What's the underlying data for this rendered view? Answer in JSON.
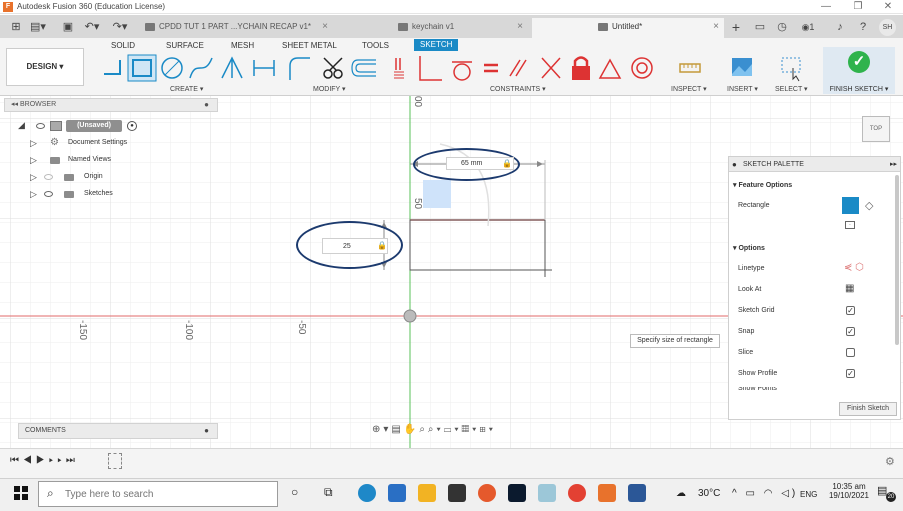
{
  "window": {
    "title": "Autodesk Fusion 360 (Education License)",
    "logo_letter": "F"
  },
  "tabs": [
    {
      "label": "CPDD TUT 1 PART ...YCHAIN RECAP v1*",
      "close": "×"
    },
    {
      "label": "keychain v1",
      "close": "×"
    },
    {
      "label": "Untitled*",
      "close": "×"
    }
  ],
  "tabbar_icons": {
    "new_tab": "+",
    "notification_count": "1",
    "avatar": "SH"
  },
  "ribbon": {
    "design_label": "DESIGN ▾",
    "tabs": [
      "SOLID",
      "SURFACE",
      "MESH",
      "SHEET METAL",
      "TOOLS",
      "SKETCH"
    ],
    "groups": [
      "CREATE ▾",
      "MODIFY ▾",
      "CONSTRAINTS ▾",
      "INSPECT ▾",
      "INSERT ▾",
      "SELECT ▾"
    ],
    "finish_sketch_label": "FINISH SKETCH ▾"
  },
  "browser": {
    "header": "BROWSER",
    "collapse": "◂◂",
    "root": "(Unsaved)",
    "items": [
      "Document Settings",
      "Named Views",
      "Origin",
      "Sketches"
    ]
  },
  "canvas": {
    "axis_labels": [
      "-150",
      "-100",
      "-50",
      "50",
      "00"
    ],
    "width_dim": "65 mm",
    "height_dim": "25",
    "tooltip": "Specify size of rectangle",
    "viewcube": "TOP"
  },
  "palette": {
    "header": "SKETCH PALETTE",
    "feature_options_title": "▾ Feature Options",
    "rectangle_label": "Rectangle",
    "options_title": "▾ Options",
    "options": [
      {
        "label": "Linetype",
        "state": "icon"
      },
      {
        "label": "Look At",
        "state": "icon"
      },
      {
        "label": "Sketch Grid",
        "state": "checked"
      },
      {
        "label": "Snap",
        "state": "checked"
      },
      {
        "label": "Slice",
        "state": "unchecked"
      },
      {
        "label": "Show Profile",
        "state": "checked"
      },
      {
        "label": "Show Points",
        "state": "checked"
      }
    ],
    "finish_button": "Finish Sketch"
  },
  "comments": {
    "label": "COMMENTS"
  },
  "taskbar": {
    "search_placeholder": "Type here to search",
    "temperature": "30°C",
    "lang": "ENG",
    "time": "10:35 am",
    "date": "19/10/2021",
    "notif_count": "20"
  },
  "colors": {
    "accent": "#1a8ac6",
    "finish_green": "#2fb34c",
    "annotation": "#1c3a6e",
    "red_axis": "#e06868",
    "green_axis": "#58c258"
  }
}
